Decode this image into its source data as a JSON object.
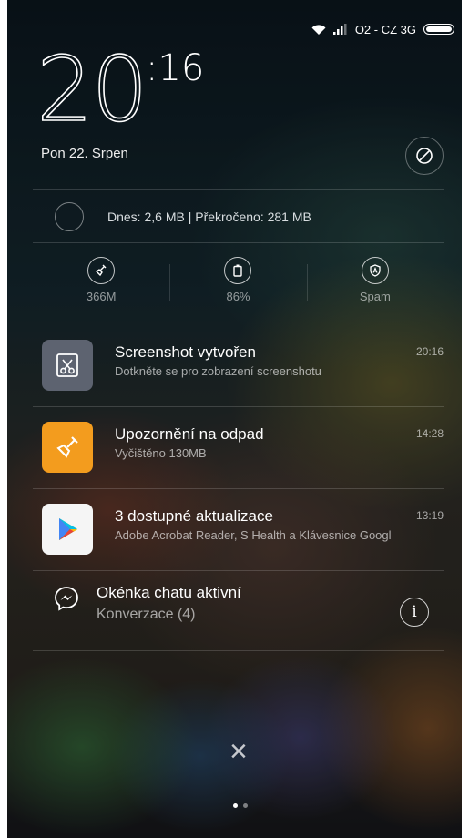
{
  "status_bar": {
    "carrier": "O2 - CZ 3G",
    "icons": [
      "wifi-icon",
      "signal-icon",
      "battery-icon"
    ]
  },
  "clock": {
    "hours": "20",
    "minutes": ":16"
  },
  "date": "Pon 22. Srpen",
  "quick": {
    "data_usage": "Dnes: 2,6 MB | Překročeno: 281 MB",
    "tools": [
      {
        "icon": "broom-icon",
        "label": "366M"
      },
      {
        "icon": "battery-icon",
        "label": "86%"
      },
      {
        "icon": "shield-icon",
        "label": "Spam"
      }
    ]
  },
  "notifications": [
    {
      "icon": "screenshot-icon",
      "icon_color": "#5d6370",
      "title": "Screenshot vytvořen",
      "subtitle": "Dotkněte se pro zobrazení screenshotu",
      "time": "20:16"
    },
    {
      "icon": "cleaner-icon",
      "icon_color": "#f39c1e",
      "title": "Upozornění na odpad",
      "subtitle": "Vyčištěno 130MB",
      "time": "14:28"
    },
    {
      "icon": "play-store-icon",
      "icon_color": "#f5f5f5",
      "title": "3 dostupné aktualizace",
      "subtitle": "Adobe Acrobat Reader, S Health a Klávesnice Googl",
      "time": "13:19"
    }
  ],
  "chat": {
    "title": "Okénka chatu aktivní",
    "subtitle": "Konverzace (4)",
    "info": "i"
  },
  "close_symbol": "×",
  "pages": {
    "count": 2,
    "active": 0
  }
}
